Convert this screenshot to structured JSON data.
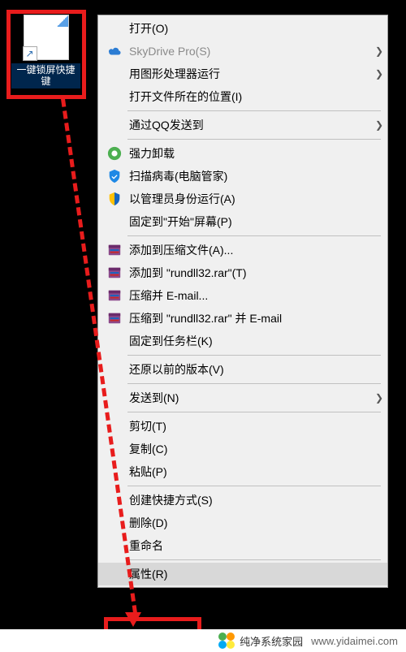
{
  "desktop_icon": {
    "label": "一键锁屏快捷键",
    "shortcut_arrow": "↗"
  },
  "menu": {
    "items": [
      {
        "label": "打开(O)",
        "icon": "",
        "sub": false
      },
      {
        "label": "SkyDrive Pro(S)",
        "icon": "cloud",
        "sub": true,
        "disabled": true
      },
      {
        "label": "用图形处理器运行",
        "icon": "",
        "sub": true
      },
      {
        "label": "打开文件所在的位置(I)",
        "icon": "",
        "sub": false
      },
      {
        "sep": true
      },
      {
        "label": "通过QQ发送到",
        "icon": "",
        "sub": true
      },
      {
        "sep": true
      },
      {
        "label": "强力卸载",
        "icon": "uninstall",
        "sub": false
      },
      {
        "label": "扫描病毒(电脑管家)",
        "icon": "scan",
        "sub": false
      },
      {
        "label": "以管理员身份运行(A)",
        "icon": "shield",
        "sub": false
      },
      {
        "label": "固定到\"开始\"屏幕(P)",
        "icon": "",
        "sub": false
      },
      {
        "sep": true
      },
      {
        "label": "添加到压缩文件(A)...",
        "icon": "rar",
        "sub": false
      },
      {
        "label": "添加到 \"rundll32.rar\"(T)",
        "icon": "rar",
        "sub": false
      },
      {
        "label": "压缩并 E-mail...",
        "icon": "rar",
        "sub": false
      },
      {
        "label": "压缩到 \"rundll32.rar\" 并 E-mail",
        "icon": "rar",
        "sub": false
      },
      {
        "label": "固定到任务栏(K)",
        "icon": "",
        "sub": false
      },
      {
        "sep": true
      },
      {
        "label": "还原以前的版本(V)",
        "icon": "",
        "sub": false
      },
      {
        "sep": true
      },
      {
        "label": "发送到(N)",
        "icon": "",
        "sub": true
      },
      {
        "sep": true
      },
      {
        "label": "剪切(T)",
        "icon": "",
        "sub": false
      },
      {
        "label": "复制(C)",
        "icon": "",
        "sub": false
      },
      {
        "label": "粘贴(P)",
        "icon": "",
        "sub": false
      },
      {
        "sep": true
      },
      {
        "label": "创建快捷方式(S)",
        "icon": "",
        "sub": false
      },
      {
        "label": "删除(D)",
        "icon": "",
        "sub": false
      },
      {
        "label": "重命名",
        "icon": "",
        "sub": false
      },
      {
        "sep": true
      },
      {
        "label": "属性(R)",
        "icon": "",
        "sub": false,
        "highlighted": true
      }
    ]
  },
  "footer": {
    "brand": "纯净系统家园",
    "url": "www.yidaimei.com"
  },
  "icons_text": {
    "submenu_arrow": "❯"
  }
}
